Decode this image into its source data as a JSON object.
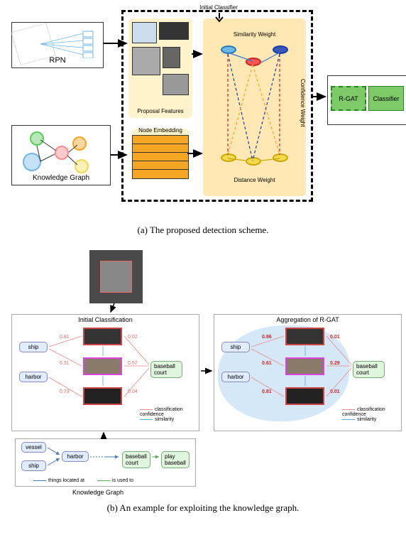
{
  "diagram_a": {
    "rpn_label": "RPN",
    "kg_label": "Knowledge Graph",
    "proposal_features_label": "Proposal Features",
    "node_embedding_label": "Node Embedding",
    "initial_classifier_label": "Initial Classifier",
    "similarity_weight_label": "Similarity Weight",
    "confidence_weight_label": "Confidence Weight",
    "distance_weight_label": "Distance Weight",
    "rgat_label": "R-GAT",
    "classifier_label": "Classifier",
    "kg_nodes": [
      {
        "color": "#5bc95b"
      },
      {
        "color": "#f5a623"
      },
      {
        "color": "#f58f8f"
      },
      {
        "color": "#6db5e8"
      },
      {
        "color": "#f2d94c"
      }
    ]
  },
  "caption_a": "(a) The proposed detection scheme.",
  "diagram_b": {
    "initial_classification_title": "Initial Classification",
    "rgat_aggregation_title": "Aggregation of R-GAT",
    "chips": {
      "ship": "ship",
      "harbor": "harbor",
      "baseball_court": "baseball court",
      "vessel": "vessel",
      "play_baseball": "play baseball"
    },
    "confidences_initial": {
      "c1": "0.81",
      "c2": "0.31",
      "c3": "0.73",
      "c4": "0.02",
      "c5": "0.57",
      "c6": "0.04"
    },
    "confidences_rgat": {
      "c1": "0.86",
      "c2": "0.61",
      "c3": "0.81",
      "c4": "0.01",
      "c5": "0.29",
      "c6": "0.01"
    },
    "legend": {
      "classification_confidence": "classification confidence",
      "similarity": "similarity"
    },
    "kg_relations": {
      "located_at": "things located at",
      "used_to": "is used to"
    },
    "kg_title": "Knowledge Graph"
  },
  "caption_b": "(b) An example for exploiting the knowledge graph."
}
